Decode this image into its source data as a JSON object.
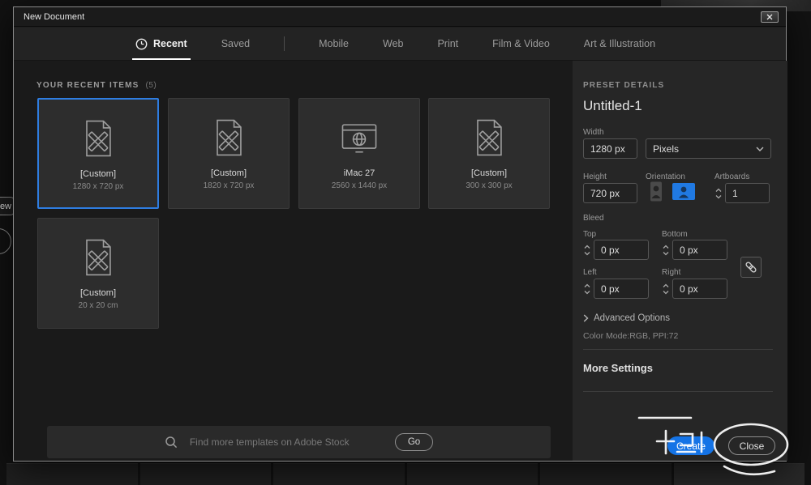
{
  "window": {
    "title": "New Document"
  },
  "tabs": {
    "recent": "Recent",
    "saved": "Saved",
    "mobile": "Mobile",
    "web": "Web",
    "print": "Print",
    "film_video": "Film & Video",
    "art_illustration": "Art & Illustration"
  },
  "recent_section": {
    "heading": "YOUR RECENT ITEMS",
    "count": "(5)"
  },
  "cards": [
    {
      "name": "[Custom]",
      "dims": "1280 x 720 px"
    },
    {
      "name": "[Custom]",
      "dims": "1820 x 720 px"
    },
    {
      "name": "iMac 27",
      "dims": "2560 x 1440 px"
    },
    {
      "name": "[Custom]",
      "dims": "300 x 300 px"
    },
    {
      "name": "[Custom]",
      "dims": "20 x 20 cm"
    }
  ],
  "search": {
    "placeholder": "Find more templates on Adobe Stock",
    "go": "Go"
  },
  "preset": {
    "heading": "PRESET DETAILS",
    "name": "Untitled-1",
    "width_label": "Width",
    "width_value": "1280 px",
    "unit_value": "Pixels",
    "height_label": "Height",
    "height_value": "720 px",
    "orientation_label": "Orientation",
    "artboards_label": "Artboards",
    "artboards_value": "1",
    "bleed_label": "Bleed",
    "bleed_top_label": "Top",
    "bleed_top_value": "0 px",
    "bleed_bottom_label": "Bottom",
    "bleed_bottom_value": "0 px",
    "bleed_left_label": "Left",
    "bleed_left_value": "0 px",
    "bleed_right_label": "Right",
    "bleed_right_value": "0 px",
    "advanced_label": "Advanced Options",
    "color_mode": "Color Mode:RGB, PPI:72",
    "more_settings": "More Settings",
    "create_label": "Create",
    "close_label": "Close"
  },
  "background": {
    "fragment_text": "ew"
  },
  "colors": {
    "accent": "#1473e6",
    "selection_border": "#2e7de1"
  }
}
